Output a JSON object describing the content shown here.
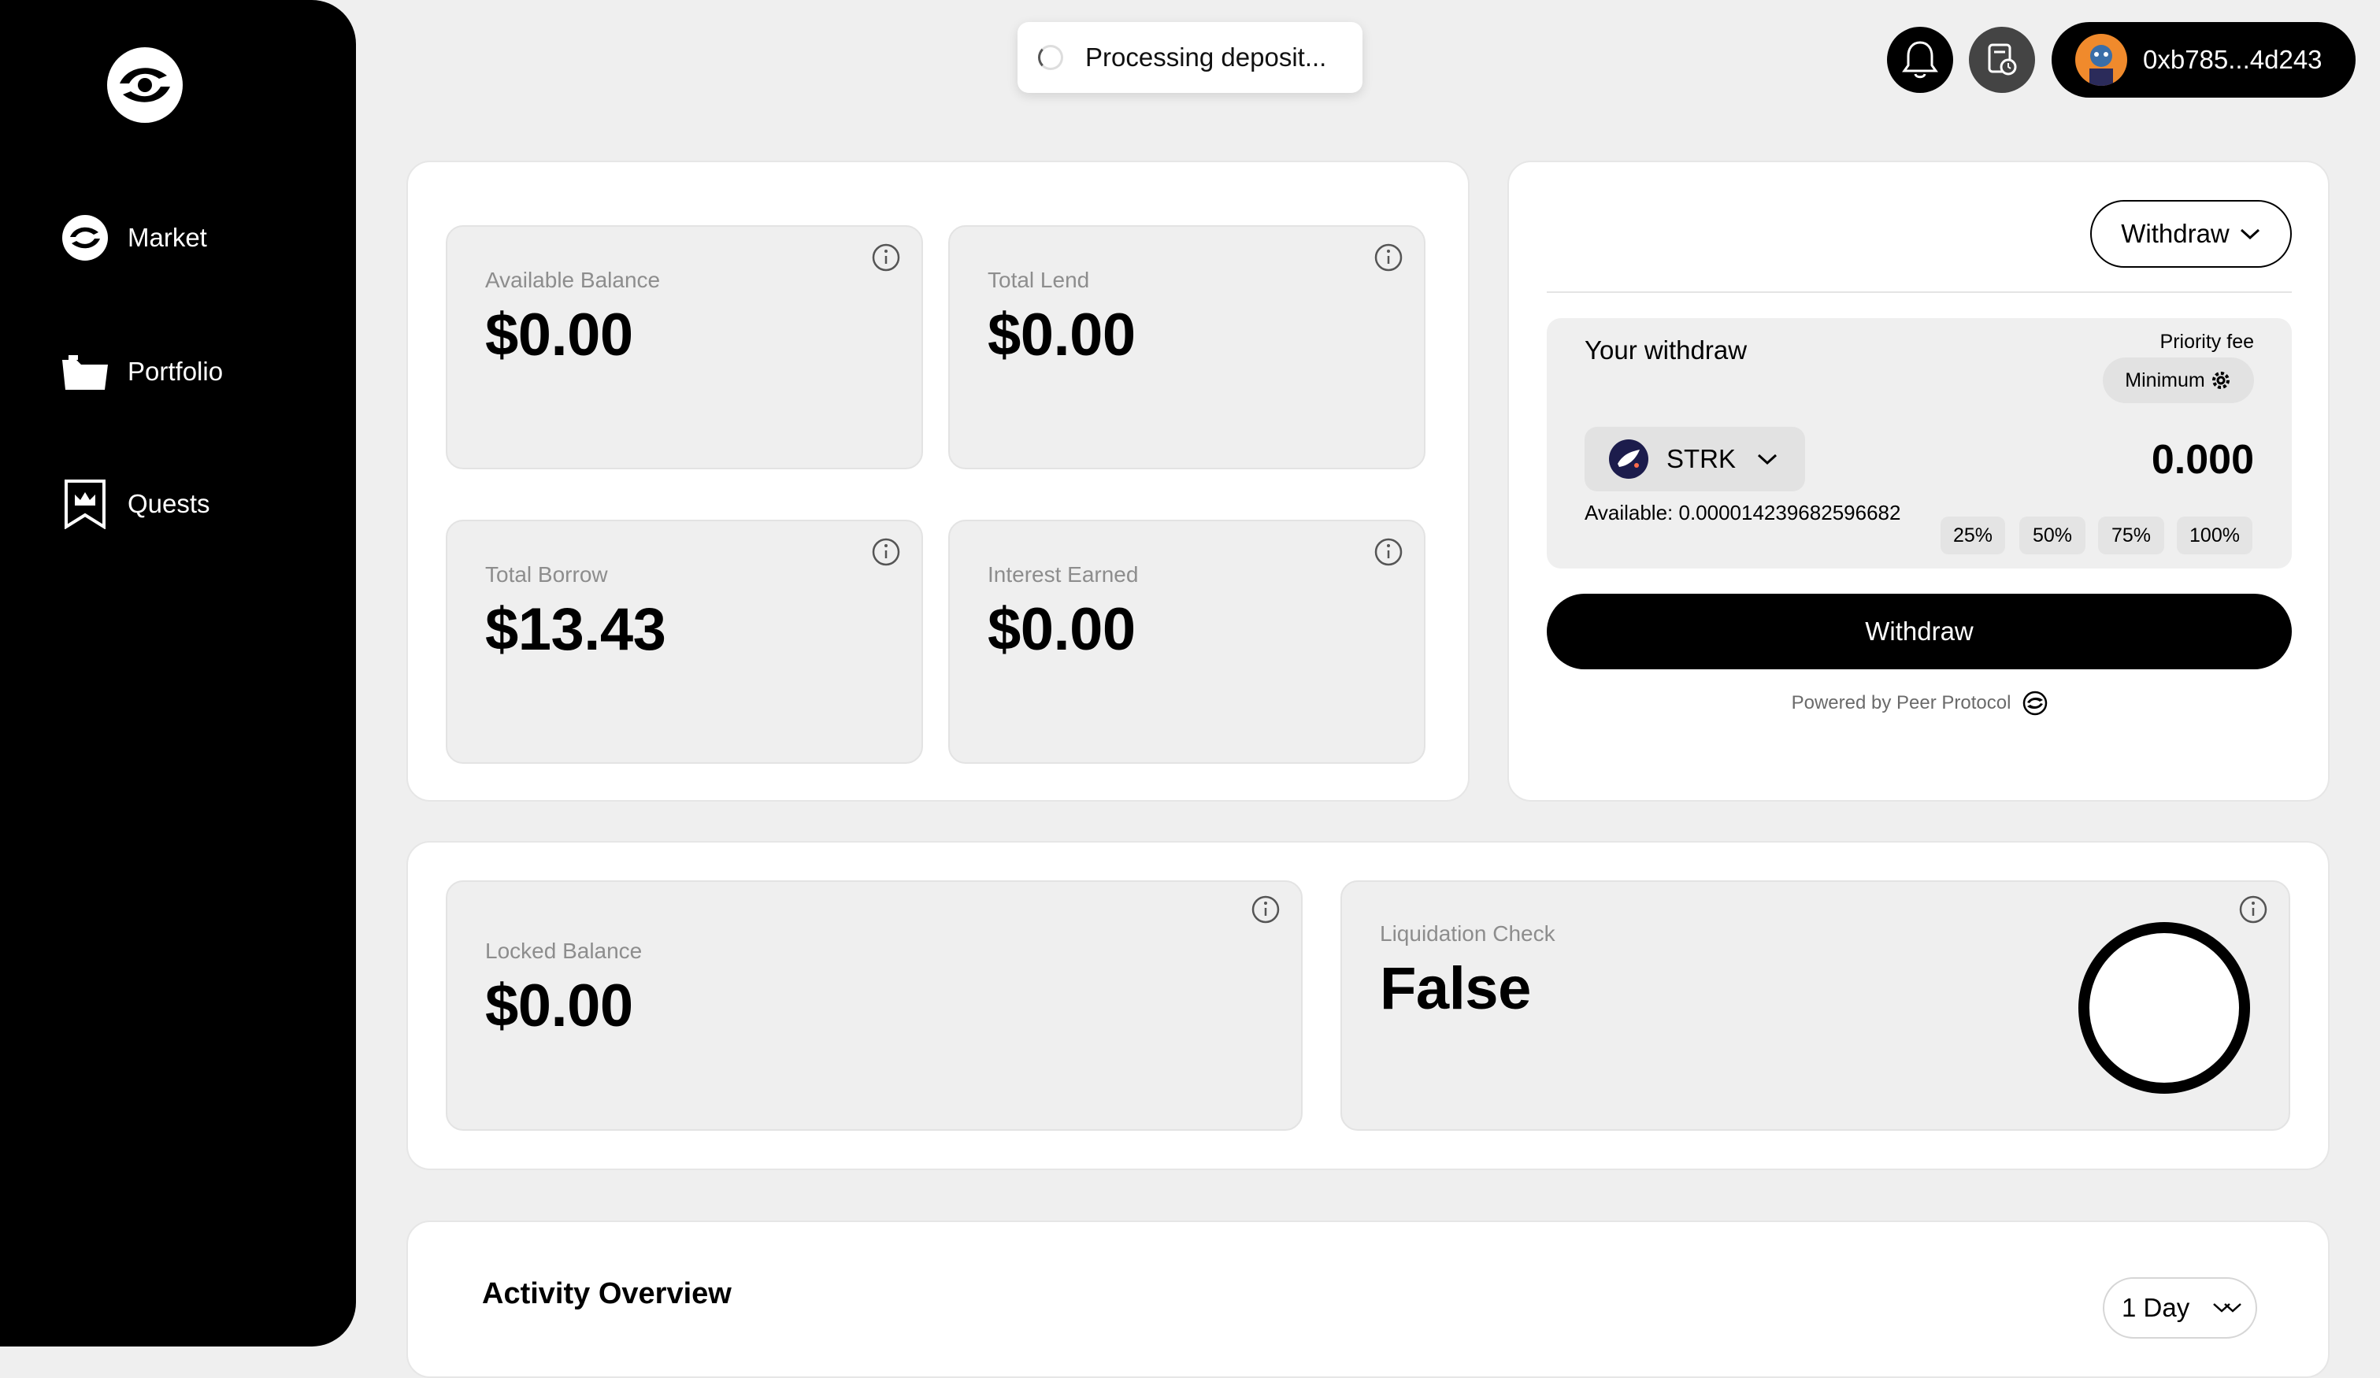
{
  "sidebar": {
    "items": [
      {
        "label": "Market",
        "icon": "peer-protocol-icon"
      },
      {
        "label": "Portfolio",
        "icon": "folder-icon"
      },
      {
        "label": "Quests",
        "icon": "crown-banner-icon"
      }
    ]
  },
  "toast": {
    "text": "Processing deposit..."
  },
  "header": {
    "wallet_address": "0xb785...4d243"
  },
  "stats": {
    "available_balance": {
      "label": "Available Balance",
      "value": "$0.00"
    },
    "total_lend": {
      "label": "Total Lend",
      "value": "$0.00"
    },
    "total_borrow": {
      "label": "Total Borrow",
      "value": "$13.43"
    },
    "interest_earned": {
      "label": "Interest Earned",
      "value": "$0.00"
    },
    "locked_balance": {
      "label": "Locked Balance",
      "value": "$0.00"
    },
    "liquidation_check": {
      "label": "Liquidation Check",
      "value": "False"
    }
  },
  "withdraw_panel": {
    "mode_label": "Withdraw",
    "title": "Your withdraw",
    "priority_fee_label": "Priority fee",
    "priority_fee_value": "Minimum",
    "token": "STRK",
    "amount": "0.000",
    "available": "Available: 0.000014239682596682",
    "percent_options": [
      "25%",
      "50%",
      "75%",
      "100%"
    ],
    "submit_label": "Withdraw",
    "powered_by": "Powered by Peer Protocol"
  },
  "activity": {
    "title": "Activity Overview",
    "range": "1 Day"
  },
  "colors": {
    "sidebar": "#000000",
    "background": "#efefef",
    "card": "#efefef",
    "accent": "#000000"
  }
}
